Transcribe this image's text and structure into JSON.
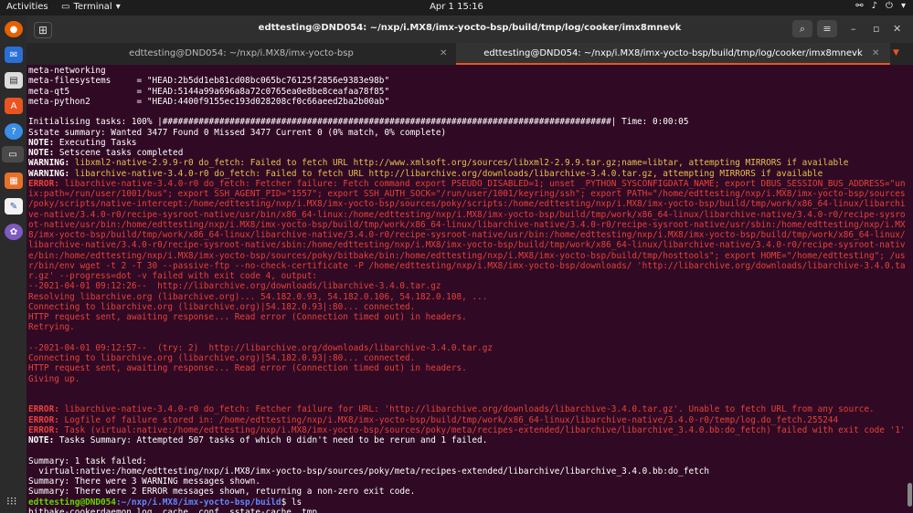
{
  "topbar": {
    "activities": "Activities",
    "app_name": "Terminal",
    "clock": "Apr 1  15:16"
  },
  "window": {
    "title": "edttesting@DND054: ~/nxp/i.MX8/imx-yocto-bsp/build/tmp/log/cooker/imx8mnevk"
  },
  "tabs": [
    {
      "label": "edttesting@DND054: ~/nxp/i.MX8/imx-yocto-bsp"
    },
    {
      "label": "edttesting@DND054: ~/nxp/i.MX8/imx-yocto-bsp/build/tmp/log/cooker/imx8mnevk"
    }
  ],
  "terminal": {
    "lines": [
      {
        "text": "meta-networking"
      },
      {
        "text": "meta-filesystems     = \"HEAD:2b5dd1eb81cd08bc065bc76125f2856e9383e98b\""
      },
      {
        "text": "meta-qt5             = \"HEAD:5144a99a696a8a72c0765ea0e8be8ceafaa78f85\""
      },
      {
        "text": "meta-python2         = \"HEAD:4400f9155ec193d028208cf0c66aeed2ba2b00ab\""
      },
      {
        "text": ""
      },
      {
        "text": "Initialising tasks: 100% |#######################################################################################| Time: 0:00:05"
      },
      {
        "text": "Sstate summary: Wanted 3477 Found 0 Missed 3477 Current 0 (0% match, 0% complete)"
      },
      {
        "prefix": "NOTE:",
        "text": " Executing Tasks",
        "kind": "note"
      },
      {
        "prefix": "NOTE:",
        "text": " Setscene tasks completed",
        "kind": "note"
      },
      {
        "prefix": "WARNING:",
        "text": " libxml2-native-2.9.9-r0 do_fetch: Failed to fetch URL http://www.xmlsoft.org/sources/libxml2-2.9.9.tar.gz;name=libtar, attempting MIRRORS if available",
        "kind": "warn"
      },
      {
        "prefix": "WARNING:",
        "text": " libarchive-native-3.4.0-r0 do_fetch: Failed to fetch URL http://libarchive.org/downloads/libarchive-3.4.0.tar.gz, attempting MIRRORS if available",
        "kind": "warn"
      },
      {
        "prefix": "ERROR:",
        "text": " libarchive-native-3.4.0-r0 do_fetch: Fetcher failure: Fetch command export PSEUDO_DISABLED=1; unset _PYTHON_SYSCONFIGDATA_NAME; export DBUS_SESSION_BUS_ADDRESS=\"un",
        "kind": "err"
      },
      {
        "text": "ix:path=/run/user/1001/bus\"; export SSH_AGENT_PID=\"1557\"; export SSH_AUTH_SOCK=\"/run/user/1001/keyring/ssh\"; export PATH=\"/home/edttesting/nxp/i.MX8/imx-yocto-bsp/sources",
        "kind": "err"
      },
      {
        "text": "/poky/scripts/native-intercept:/home/edttesting/nxp/i.MX8/imx-yocto-bsp/sources/poky/scripts:/home/edttesting/nxp/i.MX8/imx-yocto-bsp/build/tmp/work/x86_64-linux/libarchi",
        "kind": "err"
      },
      {
        "text": "ve-native/3.4.0-r0/recipe-sysroot-native/usr/bin/x86_64-linux:/home/edttesting/nxp/i.MX8/imx-yocto-bsp/build/tmp/work/x86_64-linux/libarchive-native/3.4.0-r0/recipe-sysro",
        "kind": "err"
      },
      {
        "text": "ot-native/usr/bin:/home/edttesting/nxp/i.MX8/imx-yocto-bsp/build/tmp/work/x86_64-linux/libarchive-native/3.4.0-r0/recipe-sysroot-native/usr/sbin:/home/edttesting/nxp/i.MX",
        "kind": "err"
      },
      {
        "text": "8/imx-yocto-bsp/build/tmp/work/x86_64-linux/libarchive-native/3.4.0-r0/recipe-sysroot-native/usr/bin:/home/edttesting/nxp/i.MX8/imx-yocto-bsp/build/tmp/work/x86_64-linux/",
        "kind": "err"
      },
      {
        "text": "libarchive-native/3.4.0-r0/recipe-sysroot-native/sbin:/home/edttesting/nxp/i.MX8/imx-yocto-bsp/build/tmp/work/x86_64-linux/libarchive-native/3.4.0-r0/recipe-sysroot-nativ",
        "kind": "err"
      },
      {
        "text": "e/bin:/home/edttesting/nxp/i.MX8/imx-yocto-bsp/sources/poky/bitbake/bin:/home/edttesting/nxp/i.MX8/imx-yocto-bsp/build/tmp/hosttools\"; export HOME=\"/home/edttesting\"; /us",
        "kind": "err"
      },
      {
        "text": "r/bin/env wget -t 2 -T 30 --passive-ftp --no-check-certificate -P /home/edttesting/nxp/i.MX8/imx-yocto-bsp/downloads/ 'http://libarchive.org/downloads/libarchive-3.4.0.ta",
        "kind": "err"
      },
      {
        "text": "r.gz' --progress=dot -v failed with exit code 4, output:",
        "kind": "err"
      },
      {
        "text": "--2021-04-01 09:12:26--  http://libarchive.org/downloads/libarchive-3.4.0.tar.gz",
        "kind": "err"
      },
      {
        "text": "Resolving libarchive.org (libarchive.org)... 54.182.0.93, 54.182.0.106, 54.182.0.108, ...",
        "kind": "err"
      },
      {
        "text": "Connecting to libarchive.org (libarchive.org)|54.182.0.93|:80... connected.",
        "kind": "err"
      },
      {
        "text": "HTTP request sent, awaiting response... Read error (Connection timed out) in headers.",
        "kind": "err"
      },
      {
        "text": "Retrying.",
        "kind": "err"
      },
      {
        "text": ""
      },
      {
        "text": "--2021-04-01 09:12:57--  (try: 2)  http://libarchive.org/downloads/libarchive-3.4.0.tar.gz",
        "kind": "err"
      },
      {
        "text": "Connecting to libarchive.org (libarchive.org)|54.182.0.93|:80... connected.",
        "kind": "err"
      },
      {
        "text": "HTTP request sent, awaiting response... Read error (Connection timed out) in headers.",
        "kind": "err"
      },
      {
        "text": "Giving up.",
        "kind": "err"
      },
      {
        "text": ""
      },
      {
        "text": ""
      },
      {
        "prefix": "ERROR:",
        "text": " libarchive-native-3.4.0-r0 do_fetch: Fetcher failure for URL: 'http://libarchive.org/downloads/libarchive-3.4.0.tar.gz'. Unable to fetch URL from any source.",
        "kind": "err"
      },
      {
        "prefix": "ERROR:",
        "text": " Logfile of failure stored in: /home/edttesting/nxp/i.MX8/imx-yocto-bsp/build/tmp/work/x86_64-linux/libarchive-native/3.4.0-r0/temp/log.do_fetch.255244",
        "kind": "err"
      },
      {
        "prefix": "ERROR:",
        "text": " Task (virtual:native:/home/edttesting/nxp/i.MX8/imx-yocto-bsp/sources/poky/meta/recipes-extended/libarchive/libarchive_3.4.0.bb:do_fetch) failed with exit code '1'",
        "kind": "err"
      },
      {
        "prefix": "NOTE:",
        "text": " Tasks Summary: Attempted 507 tasks of which 0 didn't need to be rerun and 1 failed.",
        "kind": "note"
      },
      {
        "text": ""
      },
      {
        "text": "Summary: 1 task failed:"
      },
      {
        "text": "  virtual:native:/home/edttesting/nxp/i.MX8/imx-yocto-bsp/sources/poky/meta/recipes-extended/libarchive/libarchive_3.4.0.bb:do_fetch"
      },
      {
        "text": "Summary: There were 3 WARNING messages shown."
      },
      {
        "text": "Summary: There were 2 ERROR messages shown, returning a non-zero exit code."
      },
      {
        "user": "edttesting@DND054",
        "path": ":~/nxp/i.MX8/imx-yocto-bsp/build",
        "text": "$ ls",
        "kind": "prompt"
      },
      {
        "text": "bitbake-cookerdaemon.log  cache  conf  sstate-cache  tmp"
      }
    ]
  }
}
